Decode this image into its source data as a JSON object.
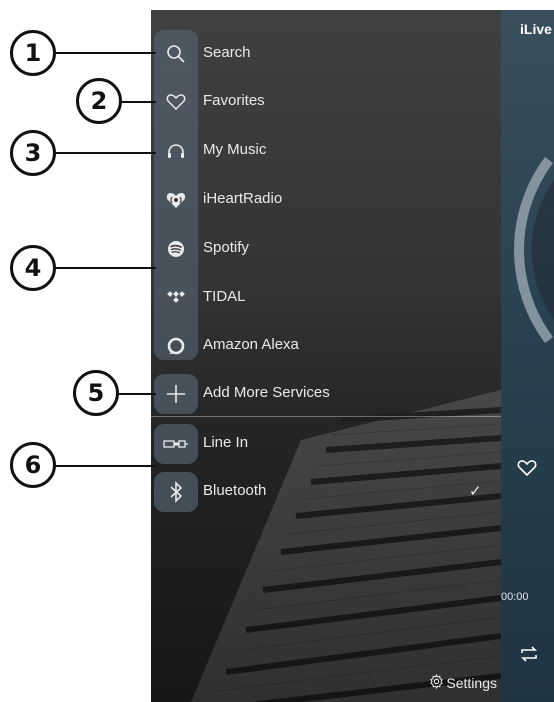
{
  "menu": {
    "items": [
      {
        "label": "Search",
        "icon": "search-icon"
      },
      {
        "label": "Favorites",
        "icon": "heart-icon"
      },
      {
        "label": "My Music",
        "icon": "headphones-icon"
      },
      {
        "label": "iHeartRadio",
        "icon": "iheartradio-icon"
      },
      {
        "label": "Spotify",
        "icon": "spotify-icon"
      },
      {
        "label": "TIDAL",
        "icon": "tidal-icon"
      },
      {
        "label": "Amazon Alexa",
        "icon": "alexa-icon"
      },
      {
        "label": "Add More Services",
        "icon": "plus-icon"
      },
      {
        "label": "Line In",
        "icon": "line-in-icon"
      },
      {
        "label": "Bluetooth",
        "icon": "bluetooth-icon",
        "checked": true
      }
    ],
    "settings_label": "Settings"
  },
  "player": {
    "title": "iLive",
    "time": "00:00"
  },
  "callouts": [
    "1",
    "2",
    "3",
    "4",
    "5",
    "6"
  ],
  "colors": {
    "panel": "#3a3a3a",
    "icon_box": "#5a6c7d",
    "player": "#28404f",
    "callout_border": "#111111"
  }
}
